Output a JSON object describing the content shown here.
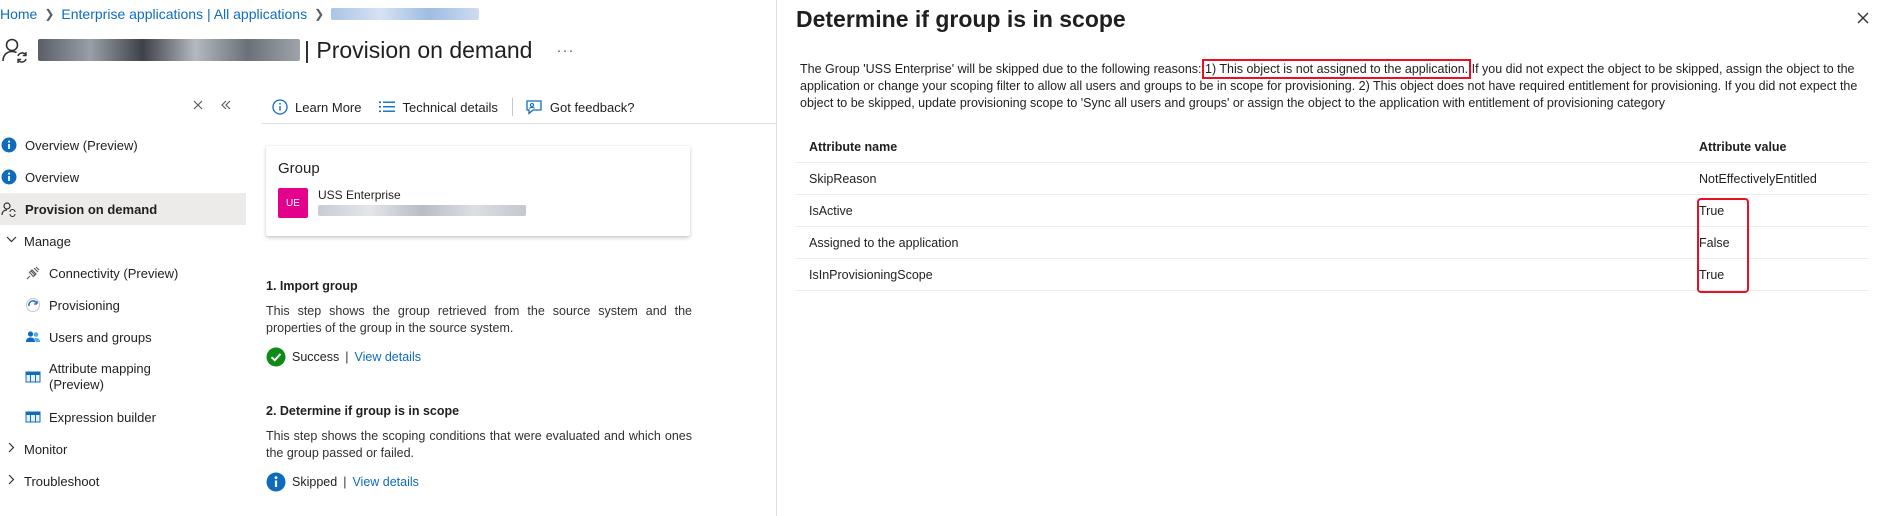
{
  "breadcrumb": {
    "home": "Home",
    "enterprise_apps": "Enterprise applications | All applications"
  },
  "header": {
    "title_suffix": "| Provision on demand",
    "more": "···"
  },
  "sidebar": {
    "items": [
      {
        "label": "Overview (Preview)"
      },
      {
        "label": "Overview"
      },
      {
        "label": "Provision on demand"
      },
      {
        "label": "Manage"
      },
      {
        "label": "Connectivity (Preview)"
      },
      {
        "label": "Provisioning"
      },
      {
        "label": "Users and groups"
      },
      {
        "label": "Attribute mapping (Preview)"
      },
      {
        "label": "Expression builder"
      },
      {
        "label": "Monitor"
      },
      {
        "label": "Troubleshoot"
      }
    ]
  },
  "toolbar": {
    "learn_more": "Learn More",
    "technical_details": "Technical details",
    "feedback": "Got feedback?"
  },
  "group_card": {
    "title": "Group",
    "avatar": "UE",
    "name": "USS Enterprise"
  },
  "steps": [
    {
      "title": "1. Import group",
      "description": "This step shows the group retrieved from the source system and the properties of the group in the source system.",
      "status": "Success",
      "link": "View details"
    },
    {
      "title": "2. Determine if group is in scope",
      "description": "This step shows the scoping conditions that were evaluated and which ones the group passed or failed.",
      "status": "Skipped",
      "link": "View details"
    }
  ],
  "panel": {
    "title": "Determine if group is in scope",
    "reason_prefix": "The Group 'USS Enterprise' will be skipped due to the following reasons:",
    "reason_highlight": "1) This object is not assigned to the application.",
    "reason_rest": " If you did not expect the object to be skipped, assign the object to the application or change your scoping filter to allow all users and groups to be in scope for provisioning. 2) This object does not have required entitlement for provisioning. If you did not expect the object to be skipped, update provisioning scope to 'Sync all users and groups' or assign the object to the application with entitlement of provisioning category",
    "table": {
      "headers": [
        "Attribute name",
        "Attribute value"
      ],
      "rows": [
        [
          "SkipReason",
          "NotEffectivelyEntitled"
        ],
        [
          "IsActive",
          "True"
        ],
        [
          "Assigned to the application",
          "False"
        ],
        [
          "IsInProvisioningScope",
          "True"
        ]
      ]
    }
  }
}
